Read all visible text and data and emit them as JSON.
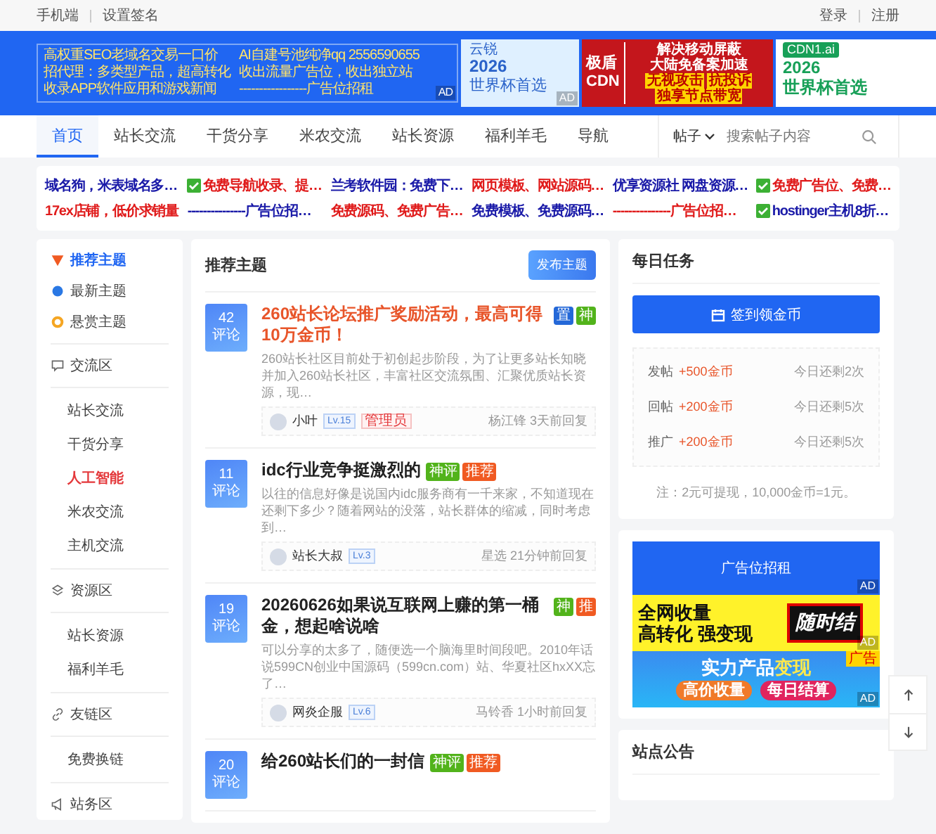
{
  "topbar": {
    "left": [
      "手机端",
      "设置签名"
    ],
    "right": [
      "登录",
      "注册"
    ]
  },
  "banner": {
    "text_ad": {
      "left": [
        "高权重SEO老域名交易一口价",
        "招代理：多类型产品，超高转化",
        "收录APP软件应用和游戏新闻"
      ],
      "right": [
        "AI自建号池纯净qq 2556590655",
        "收出流量广告位，收出独立站",
        "-----------------广告位招租"
      ],
      "badge": "AD"
    },
    "ads": [
      {
        "kind": "cup-light",
        "brand": "云锐",
        "headline": "2026",
        "subline": "世界杯首选",
        "badge": "AD"
      },
      {
        "kind": "cdn-red",
        "brand": "极盾",
        "brand2": "CDN",
        "headline": "解决移动屏蔽",
        "subline": "大陆免备案加速",
        "tags": [
          "无视攻击",
          "抗投诉",
          "独享节点带宽"
        ]
      },
      {
        "kind": "cup-green",
        "brand": "CDN1.ai",
        "headline": "2026",
        "subline": "世界杯首选"
      }
    ]
  },
  "nav": {
    "tabs": [
      {
        "label": "首页",
        "selected": true
      },
      {
        "label": "站长交流",
        "selected": false
      },
      {
        "label": "干货分享",
        "selected": false
      },
      {
        "label": "米农交流",
        "selected": false
      },
      {
        "label": "站长资源",
        "selected": false
      },
      {
        "label": "福利羊毛",
        "selected": false
      },
      {
        "label": "导航",
        "selected": false
      }
    ],
    "search": {
      "scope": "帖子",
      "placeholder": "搜索帖子内容"
    }
  },
  "links": [
    {
      "text": "域名狗，米表域名多…",
      "color": "#1a1aa8",
      "checkbox": false
    },
    {
      "text": "免费导航收录、提…",
      "color": "#e01b1b",
      "checkbox": true
    },
    {
      "text": "兰考软件园：免费下…",
      "color": "#1a1aa8",
      "checkbox": false
    },
    {
      "text": "网页模板、网站源码…",
      "color": "#e01b1b",
      "checkbox": false
    },
    {
      "text": "优享资源社 网盘资源…",
      "color": "#1a1aa8",
      "checkbox": false
    },
    {
      "text": "免费广告位、免费…",
      "color": "#e01b1b",
      "checkbox": true
    },
    {
      "text": "17ex店铺，低价求销量",
      "color": "#e01b1b",
      "checkbox": false
    },
    {
      "text": "---------------广告位招…",
      "color": "#1a1aa8",
      "checkbox": false
    },
    {
      "text": "免费源码、免费广告…",
      "color": "#e01b1b",
      "checkbox": false
    },
    {
      "text": "免费模板、免费源码…",
      "color": "#1a1aa8",
      "checkbox": false
    },
    {
      "text": "---------------广告位招…",
      "color": "#e01b1b",
      "checkbox": false
    },
    {
      "text": "hostinger主机8折…",
      "color": "#1a1aa8",
      "checkbox": true
    }
  ],
  "sidebar": {
    "items": [
      {
        "label": "推荐主题",
        "selected": true
      },
      {
        "label": "最新主题",
        "selected": false
      },
      {
        "label": "悬赏主题",
        "selected": false
      }
    ],
    "sections": [
      {
        "title": "交流区",
        "children": [
          {
            "label": "站长交流",
            "highlighted": false
          },
          {
            "label": "干货分享",
            "highlighted": false
          },
          {
            "label": "人工智能",
            "highlighted": true
          },
          {
            "label": "米农交流",
            "highlighted": false
          },
          {
            "label": "主机交流",
            "highlighted": false
          }
        ]
      },
      {
        "title": "资源区",
        "children": [
          {
            "label": "站长资源",
            "highlighted": false
          },
          {
            "label": "福利羊毛",
            "highlighted": false
          }
        ]
      },
      {
        "title": "友链区",
        "children": [
          {
            "label": "免费换链",
            "highlighted": false
          }
        ]
      },
      {
        "title": "站务区"
      }
    ]
  },
  "main": {
    "title": "推荐主题",
    "publish_button": "发布主题",
    "posts": [
      {
        "count": "42",
        "count_label": "评论",
        "title": "260站长论坛推广奖励活动，最高可得10万金币！",
        "highlighted": true,
        "tags": [
          {
            "text": "置",
            "color": "#2468d8"
          },
          {
            "text": "神",
            "color": "#52b31b"
          }
        ],
        "excerpt": "260站长社区目前处于初创起步阶段，为了让更多站长知晓并加入260站长社区，丰富社区交流氛围、汇聚优质站长资源，现…",
        "author": "小叶",
        "level": "Lv.15",
        "role": "管理员",
        "reply": "杨江锋 3天前回复"
      },
      {
        "count": "11",
        "count_label": "评论",
        "title": "idc行业竞争挺激烈的",
        "highlighted": false,
        "tags": [
          {
            "text": "神评",
            "color": "#52b31b"
          },
          {
            "text": "推荐",
            "color": "#f05a22"
          }
        ],
        "excerpt": "以往的信息好像是说国内idc服务商有一千来家，不知道现在还剩下多少？随着网站的没落，站长群体的缩减，同时考虑到…",
        "author": "站长大叔",
        "level": "Lv.3",
        "reply": "星选 21分钟前回复"
      },
      {
        "count": "19",
        "count_label": "评论",
        "title": "20260626如果说互联网上赚的第一桶金，想起啥说啥",
        "highlighted": false,
        "tags": [
          {
            "text": "神",
            "color": "#52b31b"
          },
          {
            "text": "推",
            "color": "#f05a22"
          }
        ],
        "excerpt": "可以分享的太多了，随便选一个脑海里时间段吧。2010年话说599CN创业中国源码（599cn.com）站、华夏社区hxXX忘了…",
        "author": "网炎企服",
        "level": "Lv.6",
        "reply": "马铃香 1小时前回复"
      },
      {
        "count": "20",
        "count_label": "评论",
        "title": "给260站长们的一封信",
        "highlighted": false,
        "tags": [
          {
            "text": "神评",
            "color": "#52b31b"
          },
          {
            "text": "推荐",
            "color": "#f05a22"
          }
        ]
      }
    ]
  },
  "tasks": {
    "title": "每日任务",
    "button": "签到领金币",
    "rows": [
      {
        "label": "发帖",
        "reward": "+500金币",
        "remaining": "今日还剩2次"
      },
      {
        "label": "回帖",
        "reward": "+200金币",
        "remaining": "今日还剩5次"
      },
      {
        "label": "推广",
        "reward": "+200金币",
        "remaining": "今日还剩5次"
      }
    ],
    "note": "注：2元可提现，10,000金币=1元。"
  },
  "side_ads": {
    "rent": "广告位招租",
    "rent_badge": "AD",
    "yellow": {
      "lines": [
        "全网收量",
        "高转化 强变现"
      ],
      "stamp": "随时结",
      "badge": "AD"
    },
    "blue": {
      "headline": "实力产品",
      "highlight": "变现",
      "pills": [
        "高价收量",
        "每日结算"
      ],
      "corner": "广告",
      "badge": "AD"
    }
  },
  "notice": {
    "title": "站点公告"
  }
}
